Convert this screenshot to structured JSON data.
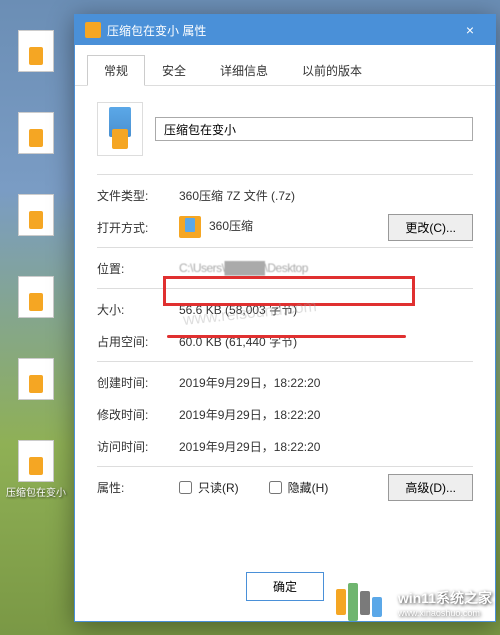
{
  "desktop": {
    "icons": [
      {
        "label": ""
      },
      {
        "label": ""
      },
      {
        "label": ""
      },
      {
        "label": ""
      },
      {
        "label": ""
      },
      {
        "label": "压缩包在变小"
      }
    ]
  },
  "titlebar": {
    "icon": "archive-icon",
    "title": "压缩包在变小 属性",
    "close": "×"
  },
  "tabs": [
    {
      "label": "常规",
      "active": true
    },
    {
      "label": "安全",
      "active": false
    },
    {
      "label": "详细信息",
      "active": false
    },
    {
      "label": "以前的版本",
      "active": false
    }
  ],
  "file": {
    "name": "压缩包在变小"
  },
  "rows": {
    "filetype_label": "文件类型:",
    "filetype_value": "360压缩 7Z 文件 (.7z)",
    "openwith_label": "打开方式:",
    "openwith_value": "360压缩",
    "change_button": "更改(C)...",
    "location_label": "位置:",
    "location_value": "C:\\Users\\█████\\Desktop",
    "size_label": "大小:",
    "size_value": "56.6 KB (58,003 字节)",
    "diskspace_label": "占用空间:",
    "diskspace_value": "60.0 KB (61,440 字节)",
    "created_label": "创建时间:",
    "created_value": "2019年9月29日，18:22:20",
    "modified_label": "修改时间:",
    "modified_value": "2019年9月29日，18:22:20",
    "accessed_label": "访问时间:",
    "accessed_value": "2019年9月29日，18:22:20",
    "attrib_label": "属性:",
    "readonly": "只读(R)",
    "hidden": "隐藏(H)",
    "advanced_button": "高级(D)..."
  },
  "buttons": {
    "ok": "确定"
  },
  "watermark": "www.relsound.com",
  "site": {
    "name": "win11系统之家",
    "url": "www.xinaoshuo.com"
  }
}
